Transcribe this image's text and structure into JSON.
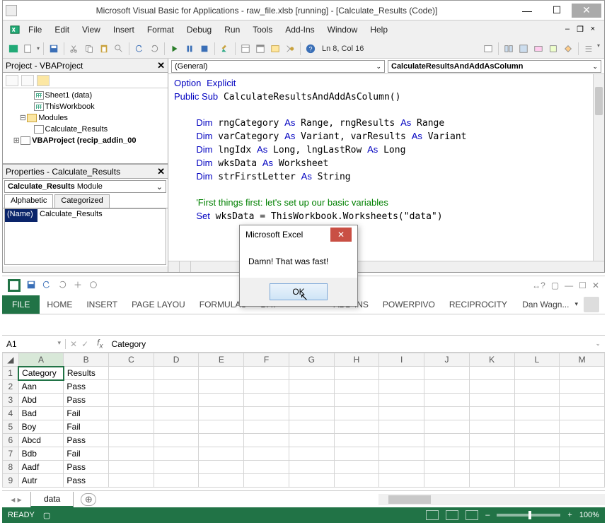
{
  "vba": {
    "title": "Microsoft Visual Basic for Applications - raw_file.xlsb [running] - [Calculate_Results (Code)]",
    "menus": [
      "File",
      "Edit",
      "View",
      "Insert",
      "Format",
      "Debug",
      "Run",
      "Tools",
      "Add-Ins",
      "Window",
      "Help"
    ],
    "cursor": "Ln 8, Col 16",
    "project": {
      "title": "Project - VBAProject",
      "items": [
        {
          "indent": 3,
          "icon": "grid",
          "label": "Sheet1 (data)"
        },
        {
          "indent": 3,
          "icon": "grid",
          "label": "ThisWorkbook"
        },
        {
          "indent": 2,
          "icon": "folder",
          "label": "Modules",
          "exp": "-"
        },
        {
          "indent": 3,
          "icon": "mod",
          "label": "Calculate_Results"
        },
        {
          "indent": 1,
          "icon": "mod",
          "label": "VBAProject (recip_addin_00",
          "exp": "+",
          "bold": true
        }
      ]
    },
    "properties": {
      "title": "Properties - Calculate_Results",
      "combo_name": "Calculate_Results",
      "combo_type": "Module",
      "tabs": [
        "Alphabetic",
        "Categorized"
      ],
      "row_name": "(Name)",
      "row_value": "Calculate_Results"
    },
    "code_dd_left": "(General)",
    "code_dd_right": "CalculateResultsAndAddAsColumn",
    "code": {
      "l1a": "Option",
      "l1b": "Explicit",
      "l2a": "Public Sub",
      "l2b": " CalculateResultsAndAddAsColumn()",
      "l3a": "Dim",
      "l3b": " rngCategory ",
      "l3c": "As",
      "l3d": " Range, rngResults ",
      "l3e": "As",
      "l3f": " Range",
      "l4a": "Dim",
      "l4b": " varCategory ",
      "l4c": "As",
      "l4d": " Variant, varResults ",
      "l4e": "As",
      "l4f": " Variant",
      "l5a": "Dim",
      "l5b": " lngIdx ",
      "l5c": "As",
      "l5d": " Long, lngLastRow ",
      "l5e": "As",
      "l5f": " Long",
      "l6a": "Dim",
      "l6b": " wksData ",
      "l6c": "As",
      "l6d": " Worksheet",
      "l7a": "Dim",
      "l7b": " strFirstLetter ",
      "l7c": "As",
      "l7d": " String",
      "l8": "'First things first: let's set up our basic variables",
      "l9a": "Set",
      "l9b": " wksData = ThisWorkbook.Worksheets(\"data\")"
    }
  },
  "msgbox": {
    "title": "Microsoft Excel",
    "text": "Damn! That was fast!",
    "ok": "OK"
  },
  "excel": {
    "ribbon": [
      "HOME",
      "INSERT",
      "PAGE LAYOU",
      "FORMULAS",
      "DAT",
      "",
      "ADD-INS",
      "POWERPIVO",
      "RECIPROCITY"
    ],
    "file": "FILE",
    "user": "Dan Wagn...",
    "namebox": "A1",
    "fx_value": "Category",
    "cols": [
      "A",
      "B",
      "C",
      "D",
      "E",
      "F",
      "G",
      "H",
      "I",
      "J",
      "K",
      "L",
      "M"
    ],
    "rows": [
      {
        "n": "1",
        "A": "Category",
        "B": "Results"
      },
      {
        "n": "2",
        "A": "Aan",
        "B": "Pass"
      },
      {
        "n": "3",
        "A": "Abd",
        "B": "Pass"
      },
      {
        "n": "4",
        "A": "Bad",
        "B": "Fail"
      },
      {
        "n": "5",
        "A": "Boy",
        "B": "Fail"
      },
      {
        "n": "6",
        "A": "Abcd",
        "B": "Pass"
      },
      {
        "n": "7",
        "A": "Bdb",
        "B": "Fail"
      },
      {
        "n": "8",
        "A": "Aadf",
        "B": "Pass"
      },
      {
        "n": "9",
        "A": "Autr",
        "B": "Pass"
      }
    ],
    "sheet_tab": "data",
    "status": "READY",
    "zoom": "100%"
  }
}
